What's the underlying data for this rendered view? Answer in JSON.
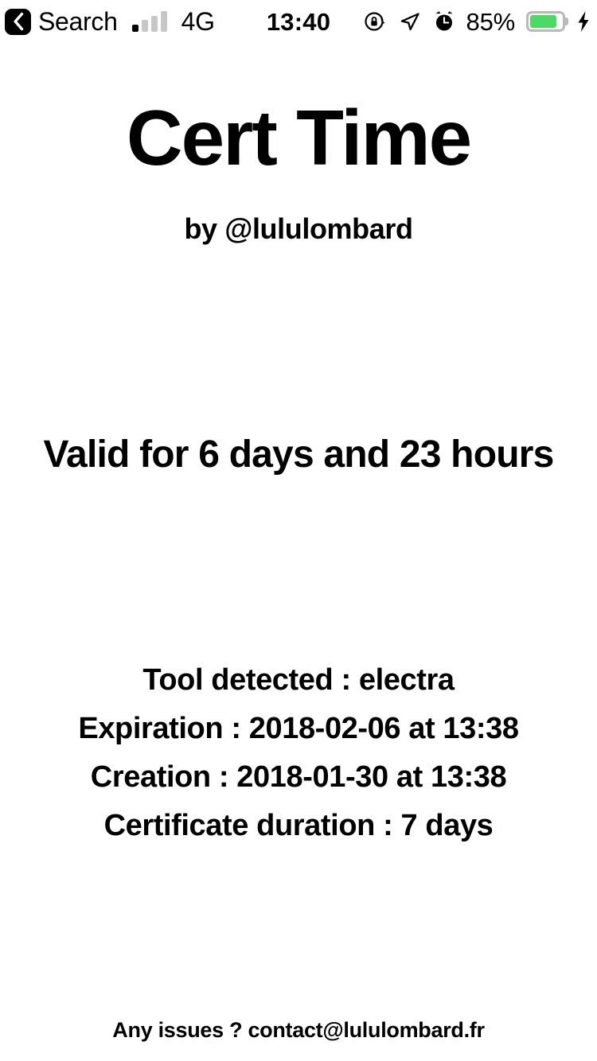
{
  "status_bar": {
    "back_icon": "chevron-left-icon",
    "carrier_label": "Search",
    "signal": {
      "icon": "signal-bars-icon",
      "bars_total": 4,
      "bars_active": 1
    },
    "network_label": "4G",
    "time": "13:40",
    "rotation_lock_icon": "rotation-lock-icon",
    "location_icon": "location-arrow-icon",
    "alarm_icon": "alarm-clock-icon",
    "battery_percent_label": "85%",
    "battery_level": 85,
    "battery_icon": "battery-icon",
    "charging_icon": "lightning-bolt-icon",
    "colors": {
      "battery_fill": "#4cd964",
      "battery_outline": "#b9b9b9",
      "signal_inactive": "#c7c7c7",
      "signal_active": "#000000"
    }
  },
  "main": {
    "app_title": "Cert Time",
    "app_author": "by @lululombard",
    "validity_text": "Valid for 6 days and 23 hours",
    "details": [
      "Tool detected : electra",
      "Expiration : 2018-02-06 at 13:38",
      "Creation : 2018-01-30 at 13:38",
      "Certificate duration : 7 days"
    ],
    "footer_note": "Any issues ? contact@lululombard.fr"
  }
}
